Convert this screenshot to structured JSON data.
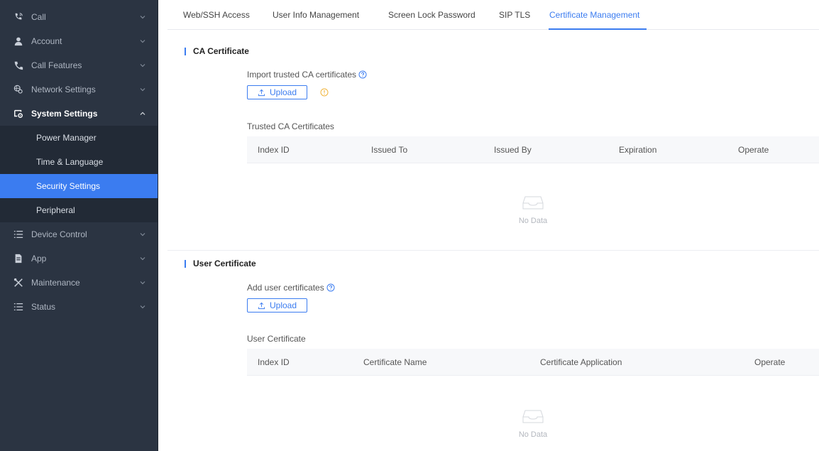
{
  "sidebar": {
    "items": [
      {
        "label": "Call",
        "icon": "phone-wave-icon"
      },
      {
        "label": "Account",
        "icon": "user-icon"
      },
      {
        "label": "Call Features",
        "icon": "phone-icon"
      },
      {
        "label": "Network Settings",
        "icon": "network-icon"
      },
      {
        "label": "System Settings",
        "icon": "system-settings-icon"
      },
      {
        "label": "Device Control",
        "icon": "list-icon"
      },
      {
        "label": "App",
        "icon": "app-icon"
      },
      {
        "label": "Maintenance",
        "icon": "tools-icon"
      },
      {
        "label": "Status",
        "icon": "list-icon"
      }
    ],
    "sub_items": [
      "Power Manager",
      "Time & Language",
      "Security Settings",
      "Peripheral"
    ],
    "active_sub_item": "Security Settings"
  },
  "tabs": [
    "Web/SSH Access",
    "User Info Management",
    "Screen Lock Password",
    "SIP TLS",
    "Certificate Management"
  ],
  "active_tab": "Certificate Management",
  "ca_section": {
    "title": "CA Certificate",
    "import_label": "Import trusted CA certificates",
    "upload_label": "Upload",
    "table_title": "Trusted CA Certificates",
    "columns": [
      "Index ID",
      "Issued To",
      "Issued By",
      "Expiration",
      "Operate"
    ],
    "empty_text": "No Data"
  },
  "user_section": {
    "title": "User Certificate",
    "add_label": "Add user certificates",
    "upload_label": "Upload",
    "table_title": "User Certificate",
    "columns": [
      "Index ID",
      "Certificate Name",
      "Certificate Application",
      "Operate"
    ],
    "empty_text": "No Data"
  },
  "colors": {
    "accent": "#3b7cf0",
    "sidebar_bg": "#2b3442",
    "warning": "#f0b43b"
  }
}
